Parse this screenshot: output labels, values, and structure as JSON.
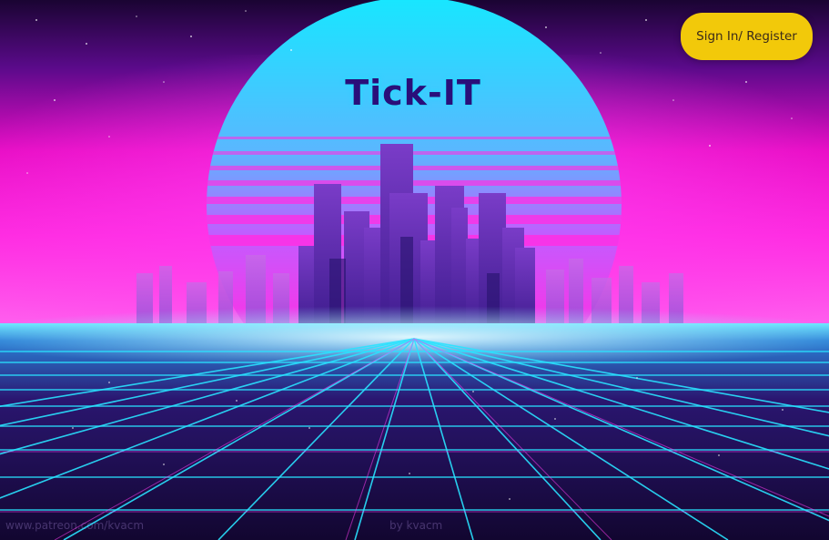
{
  "app": {
    "title": "Tick-IT"
  },
  "header": {
    "signin_label": "Sign In/ Register"
  },
  "watermark": {
    "left": "www.patreon.com/kvacm",
    "right": "by kvacm"
  },
  "colors": {
    "button_bg": "#f2c90a",
    "title_color": "#2a0f7a",
    "sun_top": "#18e6ff",
    "sky_magenta": "#ff00d4",
    "grid_cyan": "#29e3ff"
  },
  "background": {
    "scene": "synthwave city skyline with sunset and neon grid"
  }
}
